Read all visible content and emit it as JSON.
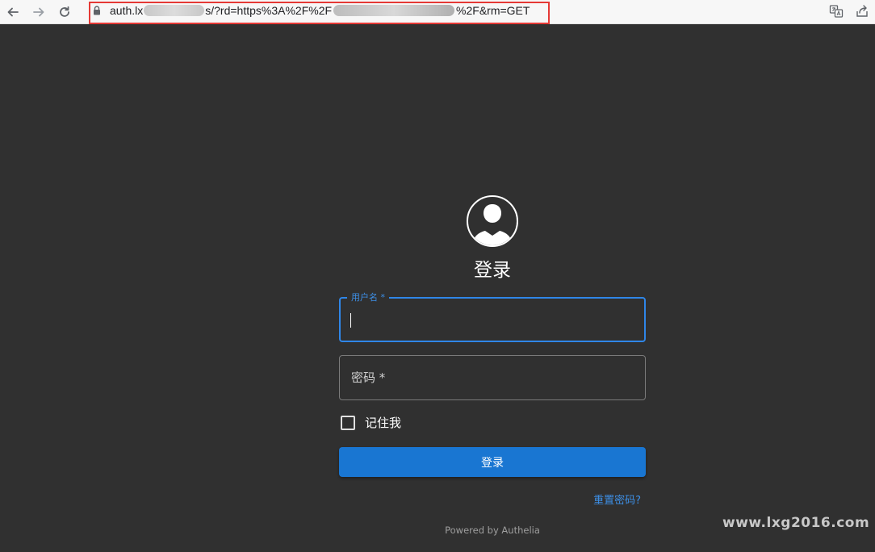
{
  "browser": {
    "url_prefix": "auth.lx",
    "url_middle": "s/?rd=https%3A%2F%2F",
    "url_suffix": "%2F&rm=GET",
    "icons": {
      "back": "arrow-left-icon",
      "forward": "arrow-right-icon",
      "reload": "reload-icon",
      "lock": "lock-icon",
      "translate": "translate-icon",
      "share": "share-icon"
    },
    "highlight_color": "#e53935"
  },
  "login": {
    "avatar": "user-avatar-icon",
    "title": "登录",
    "username_label": "用户名 *",
    "password_placeholder": "密码 *",
    "remember_me": "记住我",
    "submit": "登录",
    "reset_password": "重置密码?",
    "powered_by": "Powered by Authelia"
  },
  "watermark": "www.lxg2016.com",
  "colors": {
    "background": "#303030",
    "accent": "#1976d2",
    "link": "#3d8fe6"
  }
}
